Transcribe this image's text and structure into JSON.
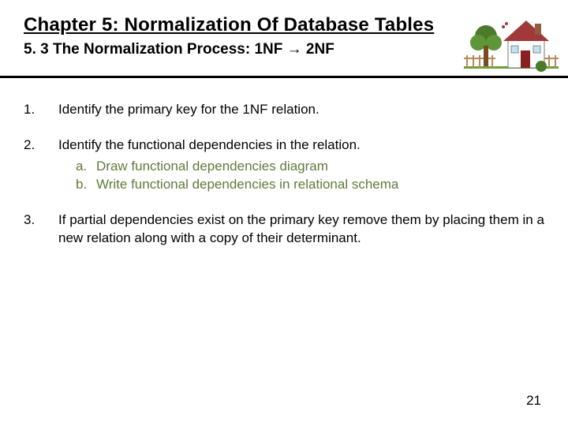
{
  "header": {
    "chapter_title": "Chapter 5: Normalization Of Database Tables",
    "subtitle_prefix": "5. 3 The Normalization Process: 1NF ",
    "subtitle_arrow": "→",
    "subtitle_suffix": " 2NF"
  },
  "list": {
    "items": [
      {
        "num": "1.",
        "text": "Identify the primary key for the 1NF relation."
      },
      {
        "num": "2.",
        "text": "Identify the functional dependencies in the relation.",
        "sub": [
          {
            "sn": "a.",
            "text": "Draw functional dependencies diagram"
          },
          {
            "sn": "b.",
            "text": "Write functional dependencies in relational schema"
          }
        ]
      },
      {
        "num": "3.",
        "text": "If partial dependencies exist on the primary key remove them by placing them in a new relation along with a copy of their determinant."
      }
    ]
  },
  "page_number": "21"
}
